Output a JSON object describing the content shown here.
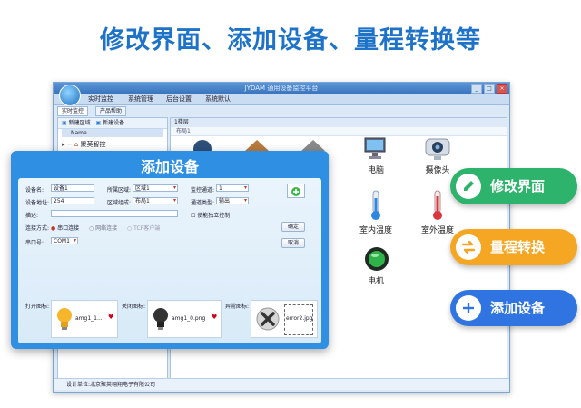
{
  "headline": "修改界面、添加设备、量程转换等",
  "window": {
    "title": "JYDAM 通用设备监控平台",
    "menu": [
      "实时监控",
      "系统管理",
      "后台设置",
      "系统默认"
    ],
    "tabs": [
      "实时监控",
      "产品帮助"
    ],
    "tree": {
      "toolbar": [
        "新建区域",
        "新建设备"
      ],
      "header": "Name",
      "node": "聚英智控"
    },
    "panel": {
      "header": "1楼层",
      "sub": "布局1"
    },
    "devices": {
      "computer": "电脑",
      "camera": "摄像头",
      "indoor_temp": "室内温度",
      "outdoor_temp": "室外温度",
      "motor": "电机"
    },
    "status": "设计单位:北京聚英翱翔电子有限公司",
    "controls": [
      "_",
      "□",
      "×"
    ]
  },
  "dialog": {
    "title": "添加设备",
    "fields": {
      "device_name_label": "设备名:",
      "device_name_value": "设备1",
      "area_label": "所属区域:",
      "area_value": "区域1",
      "channel_label": "监控通道:",
      "channel_value": "1",
      "address_label": "设备地址:",
      "address_value": "254",
      "group_label": "区域组成:",
      "group_value": "布局1",
      "type_label": "通道类型:",
      "type_value": "输出",
      "desc_label": "描述:",
      "desc_value": "",
      "enable_label": "使能独立控制",
      "connect_label": "连接方式:",
      "connect_options": [
        "串口连接",
        "网络连接",
        "TCP客户端"
      ],
      "port_label": "串口号:",
      "port_value": "COM1",
      "open_icon_label": "打开图标:",
      "open_icon_name": "amg1_1....",
      "close_icon_label": "关闭图标:",
      "close_icon_name": "amg1_0.png",
      "error_icon_label": "异常图标:",
      "error_icon_name": "error2.jpg"
    },
    "buttons": {
      "ok": "确定",
      "cancel": "取消"
    }
  },
  "pills": [
    {
      "label": "修改界面",
      "color": "#2db36b",
      "icon": "edit-icon"
    },
    {
      "label": "量程转换",
      "color": "#f5a623",
      "icon": "swap-icon"
    },
    {
      "label": "添加设备",
      "color": "#2f74e0",
      "icon": "plus-icon"
    }
  ]
}
